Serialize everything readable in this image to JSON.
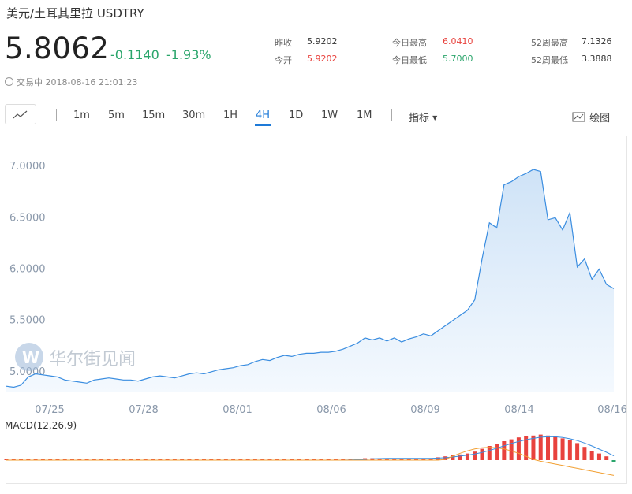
{
  "header": {
    "title": "美元/土耳其里拉  USDTRY",
    "price": "5.8062",
    "change": "-0.1140",
    "change_pct": "-1.93%",
    "status": "交易中 2018-08-16 21:01:23"
  },
  "stats": {
    "prev_close_label": "昨收",
    "prev_close": "5.9202",
    "open_label": "今开",
    "open": "5.9202",
    "high_label": "今日最高",
    "high": "6.0410",
    "low_label": "今日最低",
    "low": "5.7000",
    "w52_high_label": "52周最高",
    "w52_high": "7.1326",
    "w52_low_label": "52周最低",
    "w52_low": "3.3888"
  },
  "toolbar": {
    "timeframes": [
      "1m",
      "5m",
      "15m",
      "30m",
      "1H",
      "4H",
      "1D",
      "1W",
      "1M"
    ],
    "active": "4H",
    "indicator_label": "指标",
    "draw_label": "绘图"
  },
  "watermark": "华尔街见闻",
  "colors": {
    "line": "#3a8de0",
    "up": "#e8423d",
    "down": "#2aa56b",
    "accent": "#1e7ad8",
    "signal": "#f2a033"
  },
  "chart_data": [
    {
      "type": "area",
      "x_ticks": [
        "07/25",
        "07/28",
        "08/01",
        "08/06",
        "08/09",
        "08/14",
        "08/16"
      ],
      "y_ticks": [
        "7.0000",
        "6.5000",
        "6.0000",
        "5.5000",
        "5.0000"
      ],
      "ylim": [
        4.8,
        7.2
      ],
      "series": [
        {
          "values": [
            4.86,
            4.85,
            4.87,
            4.95,
            4.98,
            4.97,
            4.96,
            4.95,
            4.92,
            4.91,
            4.9,
            4.89,
            4.92,
            4.93,
            4.94,
            4.93,
            4.92,
            4.92,
            4.91,
            4.93,
            4.95,
            4.96,
            4.95,
            4.94,
            4.96,
            4.98,
            4.99,
            4.98,
            5.0,
            5.02,
            5.03,
            5.04,
            5.06,
            5.07,
            5.1,
            5.12,
            5.11,
            5.14,
            5.16,
            5.15,
            5.17,
            5.18,
            5.18,
            5.19,
            5.19,
            5.2,
            5.22,
            5.25,
            5.28,
            5.33,
            5.31,
            5.33,
            5.3,
            5.33,
            5.29,
            5.32,
            5.34,
            5.37,
            5.35,
            5.4,
            5.45,
            5.5,
            5.55,
            5.6,
            5.7,
            6.1,
            6.45,
            6.4,
            6.82,
            6.85,
            6.9,
            6.93,
            6.97,
            6.95,
            6.48,
            6.5,
            6.38,
            6.55,
            6.02,
            6.1,
            5.9,
            6.0,
            5.85,
            5.81
          ]
        }
      ]
    },
    {
      "type": "bar",
      "title": "MACD(12,26,9)",
      "values": [
        0,
        0,
        0,
        0,
        0,
        0,
        0,
        0,
        0,
        0,
        0,
        0,
        0,
        0,
        0,
        0,
        0,
        0,
        0,
        0,
        0,
        0,
        0,
        0,
        0,
        0,
        0,
        0,
        0,
        0,
        0,
        0,
        0,
        0,
        0,
        0,
        0,
        0,
        0,
        0,
        0,
        0,
        0,
        0,
        0,
        0,
        0,
        0.01,
        0.01,
        0.02,
        0.02,
        0.02,
        0.02,
        0.02,
        0.02,
        0.02,
        0.02,
        0.02,
        0.02,
        0.03,
        0.04,
        0.05,
        0.06,
        0.07,
        0.09,
        0.12,
        0.15,
        0.17,
        0.2,
        0.22,
        0.24,
        0.25,
        0.26,
        0.27,
        0.26,
        0.25,
        0.23,
        0.21,
        0.18,
        0.14,
        0.1,
        0.07,
        0.04,
        -0.02
      ]
    }
  ]
}
